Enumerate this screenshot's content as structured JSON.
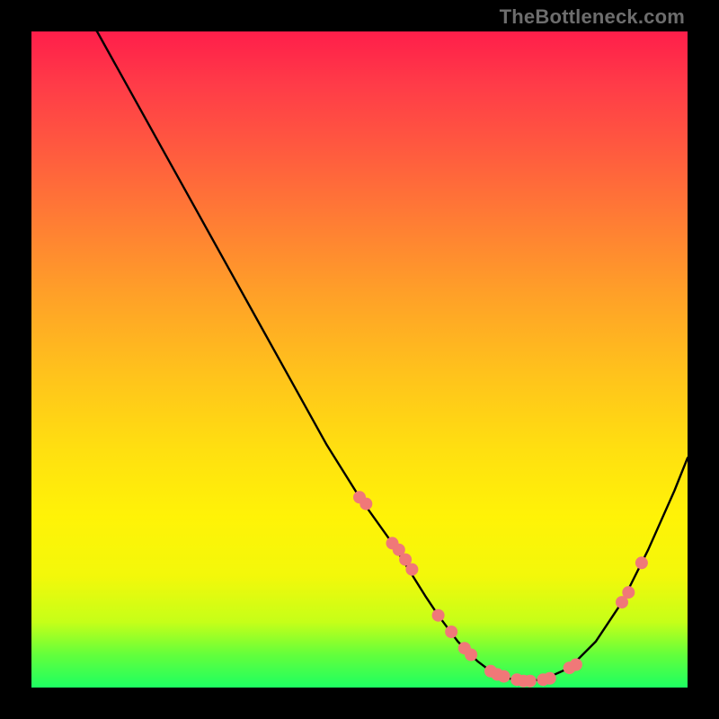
{
  "attribution": "TheBottleneck.com",
  "colors": {
    "background": "#000000",
    "curve_stroke": "#000000",
    "marker_fill": "#f07878",
    "gradient_top": "#ff1e4a",
    "gradient_mid": "#ffe010",
    "gradient_bottom": "#1dff62"
  },
  "chart_data": {
    "type": "line",
    "title": "",
    "xlabel": "",
    "ylabel": "",
    "xlim": [
      0,
      100
    ],
    "ylim": [
      0,
      100
    ],
    "curve": {
      "x": [
        0,
        10,
        15,
        20,
        25,
        30,
        35,
        40,
        45,
        50,
        55,
        60,
        62,
        65,
        68,
        70,
        72,
        75,
        78,
        82,
        86,
        90,
        94,
        98,
        100
      ],
      "y": [
        108,
        100,
        91,
        82,
        73,
        64,
        55,
        46,
        37,
        29,
        22,
        14,
        11,
        7,
        4,
        2.5,
        1.5,
        1,
        1.2,
        3,
        7,
        13,
        21,
        30,
        35
      ]
    },
    "markers": {
      "x": [
        50,
        51,
        55,
        56,
        57,
        58,
        62,
        64,
        66,
        67,
        70,
        71,
        72,
        74,
        75,
        76,
        78,
        79,
        82,
        83,
        90,
        91,
        93
      ],
      "y": [
        29,
        28,
        22,
        21,
        19.5,
        18,
        11,
        8.5,
        6,
        5,
        2.5,
        2,
        1.7,
        1.2,
        1,
        1,
        1.2,
        1.4,
        3,
        3.5,
        13,
        14.5,
        19
      ]
    }
  }
}
